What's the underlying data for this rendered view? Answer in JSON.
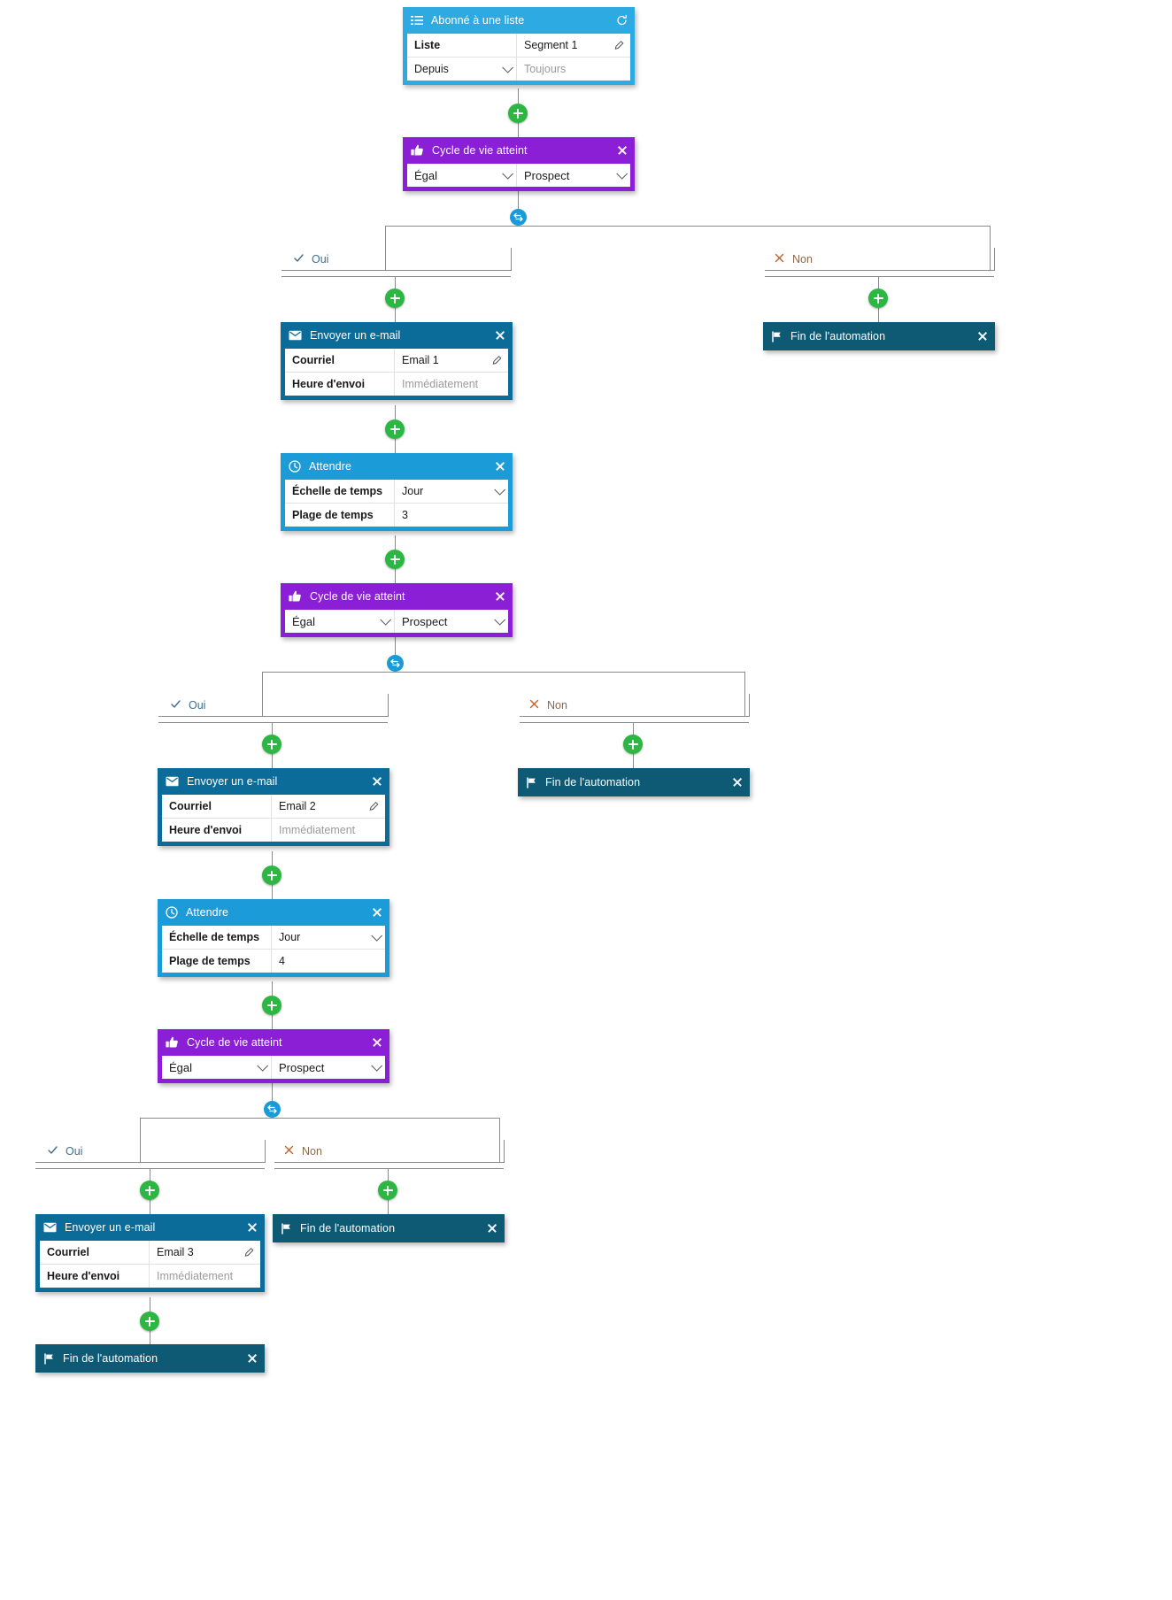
{
  "colors": {
    "trigger_blue": "#2eaae2",
    "wait_blue": "#1b9bd8",
    "email_blue": "#0b6c99",
    "end_teal": "#0e5a75",
    "condition_purple": "#8b1fd6",
    "plus_green": "#2cb742",
    "branch_node_blue": "#1a9ad7",
    "yes_text": "#3f6e8c",
    "no_text": "#8a6a4a",
    "connector_gray": "#8a8a8a"
  },
  "labels": {
    "yes": "Oui",
    "no": "Non",
    "yes_icon": "check-icon",
    "no_icon": "cross-icon",
    "add_icon": "plus-icon",
    "branch_icon": "branch-split-icon",
    "close_icon": "close-icon",
    "refresh_icon": "refresh-icon",
    "edit_icon": "pencil-icon"
  },
  "nodes": [
    {
      "id": "trigger",
      "type": "trigger",
      "icon": "list-icon",
      "title": "Abonné à une liste",
      "header_action": "refresh-icon",
      "rows": [
        {
          "label": "Liste",
          "value": "Segment 1",
          "value_kind": "text",
          "action": "pencil-icon"
        },
        {
          "label": "Depuis",
          "label_kind": "select",
          "value": "Toujours",
          "value_kind": "placeholder"
        }
      ]
    },
    {
      "id": "cond1",
      "type": "condition",
      "icon": "thumbs-up-icon",
      "title": "Cycle de vie atteint",
      "header_action": "close-icon",
      "selects": [
        {
          "value": "Égal"
        },
        {
          "value": "Prospect"
        }
      ]
    },
    {
      "id": "email1",
      "type": "email",
      "icon": "envelope-icon",
      "title": "Envoyer un e-mail",
      "header_action": "close-icon",
      "rows": [
        {
          "label": "Courriel",
          "value": "Email 1",
          "value_kind": "text",
          "action": "pencil-icon"
        },
        {
          "label": "Heure d'envoi",
          "value": "Immédiatement",
          "value_kind": "placeholder"
        }
      ]
    },
    {
      "id": "wait1",
      "type": "wait",
      "icon": "clock-icon",
      "title": "Attendre",
      "header_action": "close-icon",
      "rows": [
        {
          "label": "Échelle de temps",
          "value": "Jour",
          "value_kind": "select"
        },
        {
          "label": "Plage de temps",
          "value": "3",
          "value_kind": "text"
        }
      ]
    },
    {
      "id": "cond2",
      "type": "condition",
      "icon": "thumbs-up-icon",
      "title": "Cycle de vie atteint",
      "header_action": "close-icon",
      "selects": [
        {
          "value": "Égal"
        },
        {
          "value": "Prospect"
        }
      ]
    },
    {
      "id": "email2",
      "type": "email",
      "icon": "envelope-icon",
      "title": "Envoyer un e-mail",
      "header_action": "close-icon",
      "rows": [
        {
          "label": "Courriel",
          "value": "Email 2",
          "value_kind": "text",
          "action": "pencil-icon"
        },
        {
          "label": "Heure d'envoi",
          "value": "Immédiatement",
          "value_kind": "placeholder"
        }
      ]
    },
    {
      "id": "wait2",
      "type": "wait",
      "icon": "clock-icon",
      "title": "Attendre",
      "header_action": "close-icon",
      "rows": [
        {
          "label": "Échelle de temps",
          "value": "Jour",
          "value_kind": "select"
        },
        {
          "label": "Plage de temps",
          "value": "4",
          "value_kind": "text"
        }
      ]
    },
    {
      "id": "cond3",
      "type": "condition",
      "icon": "thumbs-up-icon",
      "title": "Cycle de vie atteint",
      "header_action": "close-icon",
      "selects": [
        {
          "value": "Égal"
        },
        {
          "value": "Prospect"
        }
      ]
    },
    {
      "id": "email3",
      "type": "email",
      "icon": "envelope-icon",
      "title": "Envoyer un e-mail",
      "header_action": "close-icon",
      "rows": [
        {
          "label": "Courriel",
          "value": "Email 3",
          "value_kind": "text",
          "action": "pencil-icon"
        },
        {
          "label": "Heure d'envoi",
          "value": "Immédiatement",
          "value_kind": "placeholder"
        }
      ]
    },
    {
      "id": "end1",
      "type": "end",
      "icon": "flag-icon",
      "title": "Fin de l'automation",
      "header_action": "close-icon"
    },
    {
      "id": "end2",
      "type": "end",
      "icon": "flag-icon",
      "title": "Fin de l'automation",
      "header_action": "close-icon"
    },
    {
      "id": "end3",
      "type": "end",
      "icon": "flag-icon",
      "title": "Fin de l'automation",
      "header_action": "close-icon"
    },
    {
      "id": "end4",
      "type": "end",
      "icon": "flag-icon",
      "title": "Fin de l'automation",
      "header_action": "close-icon"
    }
  ]
}
